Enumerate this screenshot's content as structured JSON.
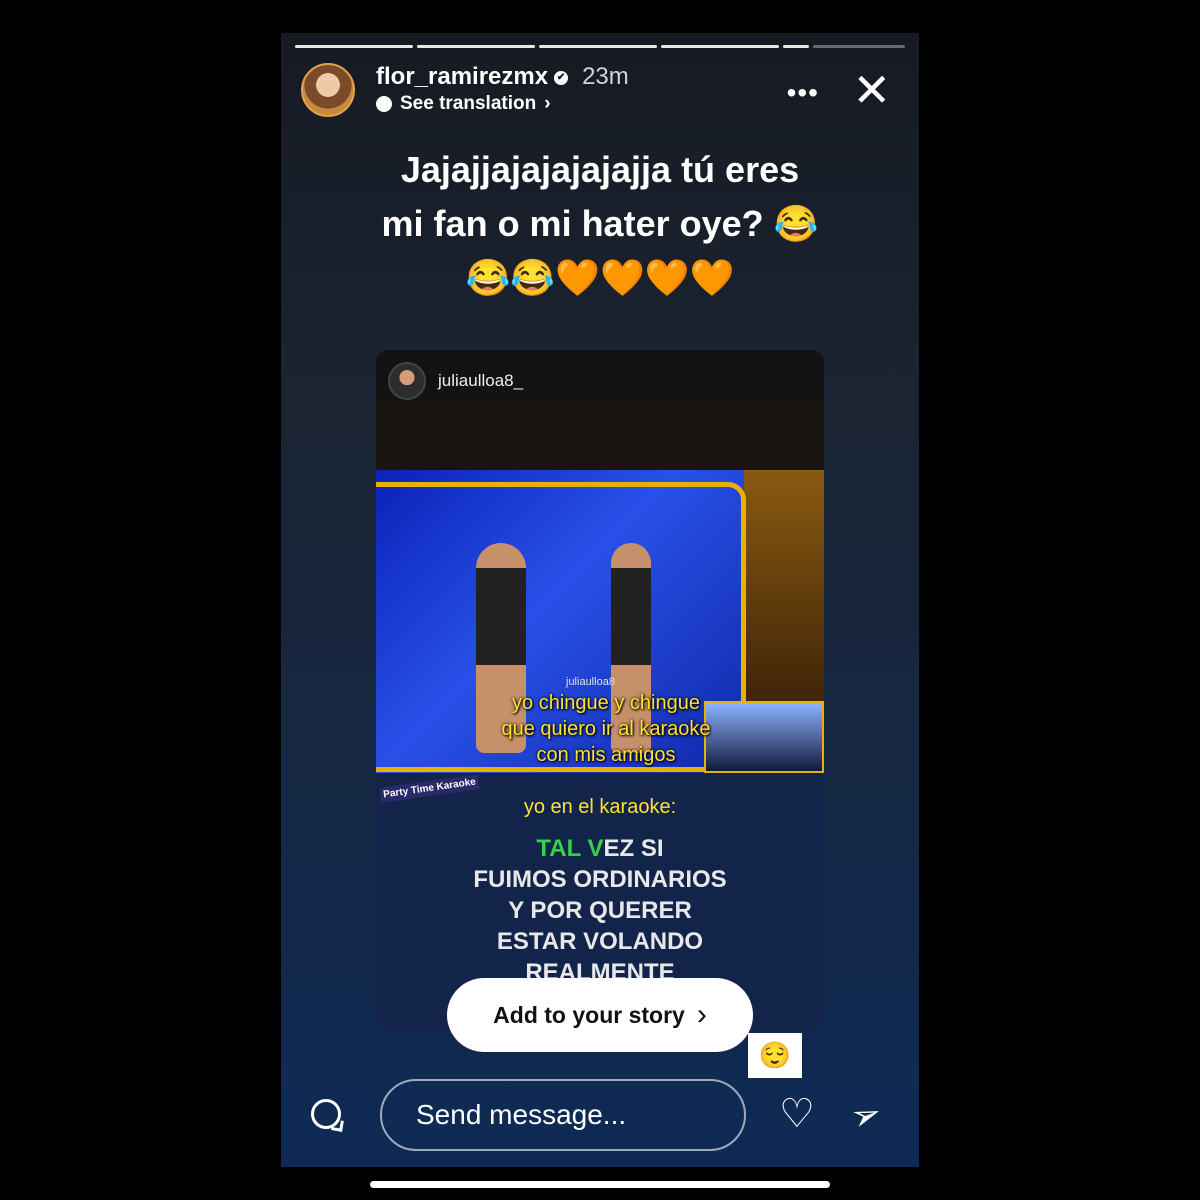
{
  "story": {
    "username": "flor_ramirezmx",
    "verified_symbol": "✔",
    "time_ago": "23m",
    "see_translation": "See translation",
    "more_symbol": "•••",
    "close_symbol": "✕",
    "caption_line1": "Jajajjajajajajajja tú eres",
    "caption_line2": "mi fan o mi hater oye? 😂",
    "caption_line3": "😂😂🧡🧡🧡🧡",
    "progress_segments": 5,
    "active_segment": 5
  },
  "shared_post": {
    "username": "juliaulloa8_",
    "video_watermark": "juliaulloa8",
    "subtitle_line1": "yo chingue y chingue",
    "subtitle_line2": "que quiero ir al karaoke",
    "subtitle_line3": "con mis amigos",
    "brand_label": "Party Time Karaoke",
    "intro": "yo en el karaoke:",
    "lyrics_hl_1": "TAL ",
    "lyrics_hl_2": "V",
    "lyrics_line1_rest": "EZ SI",
    "lyrics_line2": "FUIMOS ORDINARIOS",
    "lyrics_line3": "Y POR QUERER",
    "lyrics_line4": "ESTAR VOLANDO",
    "lyrics_line5": "REALMENTE"
  },
  "actions": {
    "add_to_story": "Add to your story",
    "chevron": "›",
    "sticker_emoji": "😌"
  },
  "footer": {
    "message_placeholder": "Send message...",
    "heart_symbol": "♡",
    "send_symbol": "➢"
  },
  "icons": [
    "camera-icon",
    "heart-icon",
    "send-icon",
    "close-icon",
    "more-icon",
    "verified-icon",
    "translation-icon"
  ],
  "colors": {
    "subtitle_yellow": "#ffe033",
    "lyric_highlight_green": "#33d34a",
    "frame_gold": "#e6b100"
  }
}
